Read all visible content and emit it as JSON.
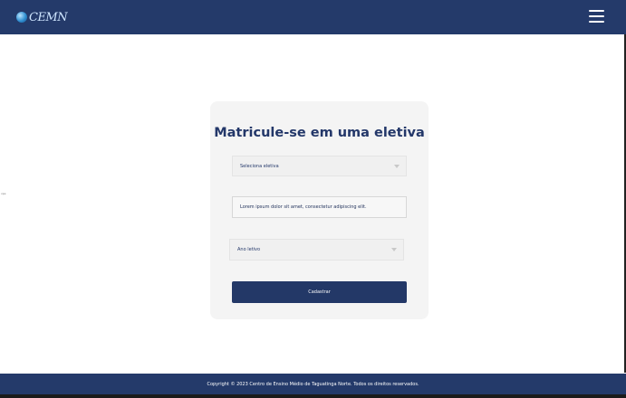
{
  "header": {
    "logo_text": "CEMN",
    "menu_icon": "hamburger-menu-icon"
  },
  "stray_text": "vpe",
  "form": {
    "title": "Matricule-se em uma eletiva",
    "elective_select": "Seleciona eletiva",
    "description_field": "Lorem ipsum dolor sit amet, consectetur adipiscing elit.",
    "year_select": "Ano letivo",
    "submit_label": "Cadastrar"
  },
  "footer": {
    "copyright": "Copyright © 2023 Centro de Ensino Médio de Taguatinga Norte. Todos os direitos reservados."
  },
  "colors": {
    "primary": "#243a6a",
    "card_bg": "#f4f4f4"
  }
}
